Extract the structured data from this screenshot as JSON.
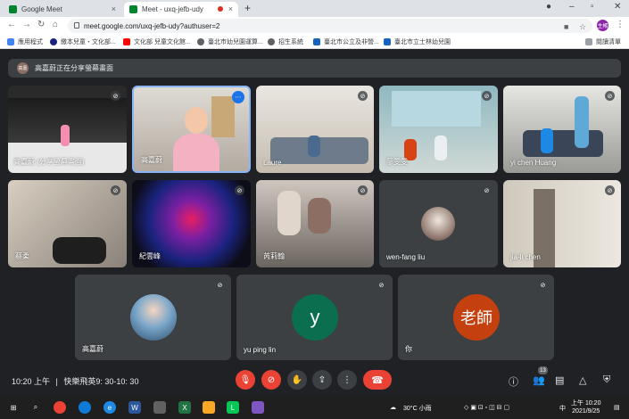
{
  "browser": {
    "tabs": [
      {
        "title": "Google Meet",
        "close": "×"
      },
      {
        "title": "Meet - uxq-jefb-udy",
        "close": "×"
      }
    ],
    "new_tab": "+",
    "url": "meet.google.com/uxq-jefb-udy?authuser=2",
    "profile_initials": "主帳",
    "bookmarks": [
      "應用程式",
      "繳本兒童・文化部...",
      "文化部 兒童文化館...",
      "臺北市幼兒園運算...",
      "招生系統",
      "臺北市公立及非營...",
      "臺北市立士林幼兒園"
    ],
    "reading_list": "閱讀清單"
  },
  "meet": {
    "banner": "高嘉蔚正在分享螢幕畫面",
    "banner_avatar": "高嘉",
    "tiles": [
      {
        "name": "高嘉蔚 (分享螢幕畫面)"
      },
      {
        "name": "高嘉蔚"
      },
      {
        "name": "Laure"
      },
      {
        "name": "廖雯雯"
      },
      {
        "name": "yi chen Huang"
      },
      {
        "name": "蔡柔"
      },
      {
        "name": "紀雲峰"
      },
      {
        "name": "芮莉翰"
      },
      {
        "name": "wen-fang liu"
      },
      {
        "name": "jia-li chen"
      },
      {
        "name": "高嘉蔚"
      },
      {
        "name": "yu ping lin",
        "initial": "y"
      },
      {
        "name": "你",
        "initial": "老師"
      }
    ],
    "colors": {
      "y_avatar": "#0b6e4f",
      "teacher_avatar": "#c5400f",
      "accent": "#8ab4f8",
      "end_call": "#ea4335"
    }
  },
  "bottom": {
    "time": "10:20 上午",
    "separator": "|",
    "meeting": "快樂飛英9:  30-10:  30",
    "participants_count": "13"
  },
  "taskbar": {
    "weather": "30°C 小雨",
    "ime": "中",
    "time": "上午 10:20",
    "date": "2021/9/25"
  }
}
